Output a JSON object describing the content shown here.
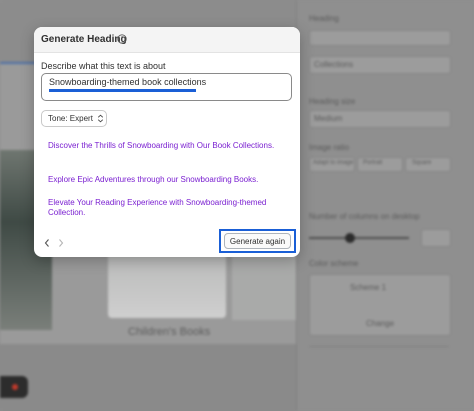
{
  "background": {
    "caption": "Children's Books",
    "right_panel": {
      "sections": [
        "Heading",
        "Heading size",
        "Image ratio",
        "Number of columns on desktop",
        "Color scheme"
      ],
      "heading_value": "Collections",
      "heading_size_value": "Medium",
      "ratio_options": [
        "Adapt to image",
        "Portrait",
        "Square"
      ],
      "color_scheme_name": "Scheme 1",
      "change_label": "Change"
    }
  },
  "dialog": {
    "title": "Generate Heading",
    "prompt_label": "Describe what this text is about",
    "prompt_value": "Snowboarding-themed book collections",
    "tone_label": "Tone: Expert",
    "suggestions": [
      "Discover the Thrills of Snowboarding with Our Book Collections.",
      "Explore Epic Adventures through our Snowboarding Books.",
      "Elevate Your Reading Experience with Snowboarding-themed Collection."
    ],
    "generate_label": "Generate again"
  },
  "colors": {
    "accent_blue": "#1a5fd6",
    "suggestion_purple": "#7a1fd1"
  },
  "icons": [
    "info-icon",
    "chevron-updown-icon",
    "chevron-left-icon",
    "chevron-right-icon"
  ]
}
